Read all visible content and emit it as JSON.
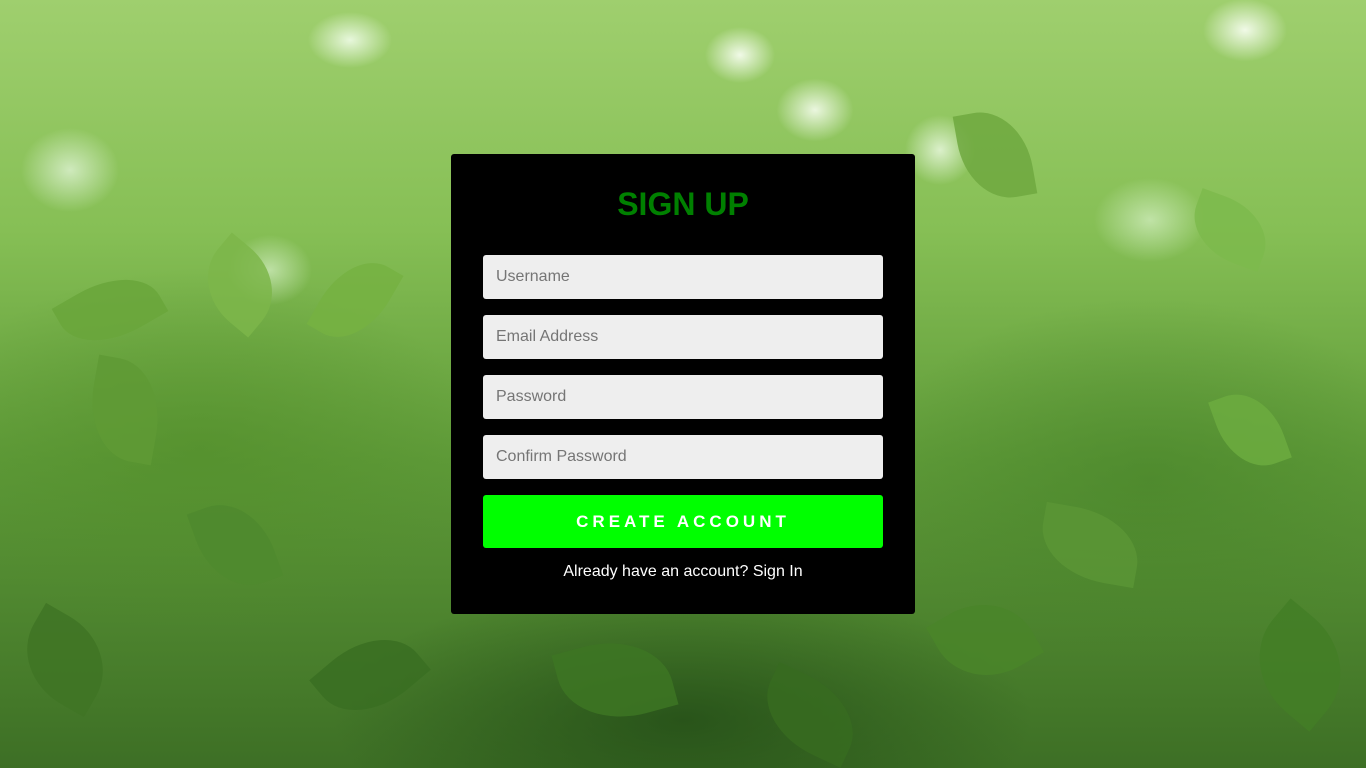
{
  "form": {
    "title": "SIGN UP",
    "username_placeholder": "Username",
    "email_placeholder": "Email Address",
    "password_placeholder": "Password",
    "confirm_password_placeholder": "Confirm Password",
    "submit_label": "CREATE ACCOUNT",
    "footer_text": "Already have an account?",
    "signin_link": "Sign In"
  },
  "colors": {
    "title": "#008000",
    "button": "#00ff00",
    "card": "#000000",
    "field_bg": "#eeeeee"
  },
  "background": {
    "image": "blurred-green-plant-leaves"
  }
}
